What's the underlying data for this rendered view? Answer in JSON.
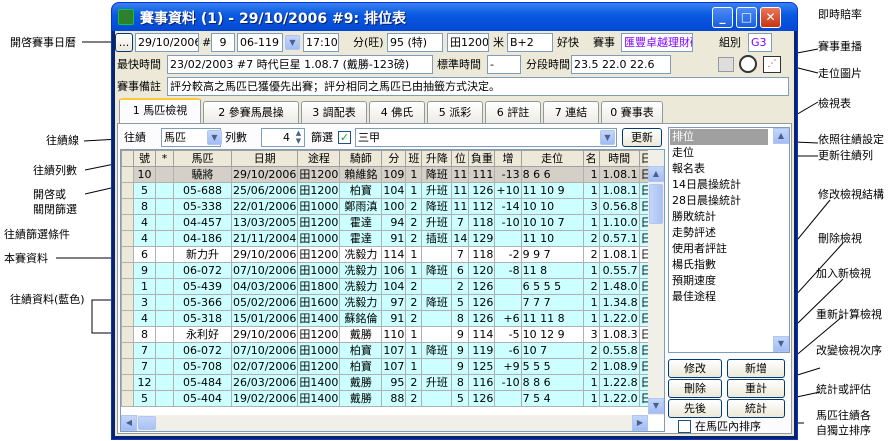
{
  "window": {
    "title": "賽事資料 (1) - 29/10/2006 #9: 排位表"
  },
  "row1": {
    "date_btn": "...",
    "date": "29/10/2006",
    "hash": "#",
    "race_no": "9",
    "race_code": "06-119",
    "time": "17:10",
    "score_label": "分(旺)",
    "score": "95 (特)",
    "distance": "田1200",
    "meter_label": "米",
    "going": "B+2",
    "going_note": "好快",
    "race_label": "賽事",
    "race_name": "匯豐卓越理財碗",
    "group_label": "組別",
    "group": "G3"
  },
  "row2": {
    "fastest_label": "最快時間",
    "fastest": "23/02/2003 #7 時代巨星 1.08.7 (戴勝-123磅)",
    "std_label": "標準時間",
    "std": "-",
    "split_label": "分段時間",
    "split": "23.5  22.0  22.6"
  },
  "row3": {
    "note_label": "賽事備註",
    "note": "評分較高之馬匹已獲優先出賽；評分相同之馬匹已由抽籤方式決定。"
  },
  "tabs": [
    {
      "label": "1 馬匹檢視"
    },
    {
      "label": "2 參賽馬晨操"
    },
    {
      "label": "3 調配表"
    },
    {
      "label": "4 佛氏"
    },
    {
      "label": "5 派彩"
    },
    {
      "label": "6 評註"
    },
    {
      "label": "7 連結"
    },
    {
      "label": "0 賽事表"
    }
  ],
  "filter": {
    "past_label": "往績",
    "past_value": "馬匹",
    "cols_label": "列數",
    "cols_value": "4",
    "filter_label": "篩選",
    "filter_value": "三甲",
    "update_btn": "更新"
  },
  "grid": {
    "headers": [
      "號",
      "*",
      "馬匹",
      "日期",
      "途程",
      "騎師",
      "分",
      "班",
      "升降",
      "位",
      "負重",
      "增",
      "走位",
      "名",
      "時間",
      "日"
    ],
    "rows": [
      {
        "t": "sel",
        "c": [
          "10",
          "",
          "驍將",
          "29/10/2006",
          "田1200",
          "賴維銘",
          "109",
          "1",
          "降班",
          "11",
          "111",
          "-13",
          "8  6  6",
          "1",
          "1.08.1",
          "日"
        ]
      },
      {
        "t": "blue",
        "c": [
          "5",
          "",
          "05-688",
          "25/06/2006",
          "田1200",
          "柏寶",
          "104",
          "1",
          "升班",
          "11",
          "126",
          "+10",
          "11 10 9",
          "1",
          "1.08.1",
          "日"
        ]
      },
      {
        "t": "blue",
        "c": [
          "8",
          "",
          "05-338",
          "22/01/2006",
          "田1000",
          "鄭雨滇",
          "100",
          "2",
          "降班",
          "11",
          "112",
          "-14",
          "10 10",
          "3",
          "0.56.8",
          "日"
        ]
      },
      {
        "t": "blue",
        "c": [
          "4",
          "",
          "04-457",
          "13/03/2005",
          "田1200",
          "霍達",
          "94",
          "2",
          "升班",
          "7",
          "118",
          "-10",
          "10 10 7",
          "1",
          "1.10.0",
          "日"
        ]
      },
      {
        "t": "blue",
        "c": [
          "4",
          "",
          "04-186",
          "21/11/2004",
          "田1000",
          "霍達",
          "91",
          "2",
          "插班",
          "14",
          "129",
          "",
          "11 10",
          "2",
          "0.57.1",
          "日"
        ]
      },
      {
        "t": "white",
        "c": [
          "6",
          "",
          "新力升",
          "29/10/2006",
          "田1200",
          "冼毅力",
          "114",
          "1",
          "",
          "7",
          "118",
          "-2",
          "9  9  7",
          "2",
          "1.08.1",
          "日"
        ]
      },
      {
        "t": "blue",
        "c": [
          "9",
          "",
          "06-072",
          "07/10/2006",
          "田1000",
          "冼毅力",
          "106",
          "1",
          "降班",
          "6",
          "120",
          "-8",
          "11 8",
          "1",
          "0.55.7",
          "日"
        ]
      },
      {
        "t": "blue",
        "c": [
          "1",
          "",
          "05-439",
          "04/03/2006",
          "田1800",
          "冼毅力",
          "104",
          "2",
          "",
          "2",
          "126",
          "",
          "6  5  5  5",
          "2",
          "1.48.0",
          "日"
        ]
      },
      {
        "t": "blue",
        "c": [
          "3",
          "",
          "05-366",
          "05/02/2006",
          "田1600",
          "冼毅力",
          "97",
          "2",
          "降班",
          "5",
          "126",
          "",
          "7  7  7",
          "1",
          "1.34.8",
          "日"
        ]
      },
      {
        "t": "blue",
        "c": [
          "4",
          "",
          "05-318",
          "15/01/2006",
          "田1400",
          "蘇銘倫",
          "91",
          "2",
          "",
          "8",
          "126",
          "+6",
          "11 11 8",
          "1",
          "1.22.0",
          "日"
        ]
      },
      {
        "t": "white",
        "c": [
          "8",
          "",
          "永利好",
          "29/10/2006",
          "田1200",
          "戴勝",
          "110",
          "1",
          "",
          "9",
          "114",
          "-5",
          "10 12 9",
          "3",
          "1.08.3",
          "日"
        ]
      },
      {
        "t": "blue",
        "c": [
          "7",
          "",
          "06-072",
          "07/10/2006",
          "田1000",
          "柏寶",
          "107",
          "1",
          "降班",
          "9",
          "119",
          "-6",
          "10 7",
          "2",
          "0.55.8",
          "日"
        ]
      },
      {
        "t": "blue",
        "c": [
          "7",
          "",
          "05-708",
          "02/07/2006",
          "田1200",
          "柏寶",
          "107",
          "1",
          "",
          "9",
          "125",
          "+9",
          "5  5  5",
          "2",
          "1.08.9",
          "日"
        ]
      },
      {
        "t": "blue",
        "c": [
          "12",
          "",
          "05-484",
          "26/03/2006",
          "田1400",
          "戴勝",
          "95",
          "2",
          "升班",
          "8",
          "116",
          "-10",
          "8  8  6",
          "1",
          "1.22.8",
          "日"
        ]
      },
      {
        "t": "blue",
        "c": [
          "5",
          "",
          "05-404",
          "19/02/2006",
          "田1400",
          "戴勝",
          "88",
          "2",
          "",
          "5",
          "126",
          "",
          "7  5  4",
          "1",
          "1.22.0",
          "日"
        ]
      }
    ]
  },
  "views": {
    "items": [
      "排位",
      "走位",
      "報名表",
      "14日晨操統計",
      "28日晨操統計",
      "勝敗統計",
      "走勢評述",
      "使用者評註",
      "楊氏指數",
      "預期速度",
      "最佳途程"
    ],
    "btn_edit": "修改",
    "btn_add": "新增",
    "btn_delete": "刪除",
    "btn_recalc": "重計",
    "btn_order": "先後",
    "btn_stats": "統計",
    "check_label": "在馬匹內排序"
  },
  "annotations": {
    "left": [
      "開啓賽事日曆",
      "往績線",
      "往績列數",
      "開啓或",
      "關閉篩選",
      "往績篩選條件",
      "本賽資料",
      "往績資料(藍色)"
    ],
    "right": [
      "即時賠率",
      "賽事重播",
      "走位圖片",
      "檢視表",
      "依照往績設定",
      "更新往績列",
      "修改檢視結構",
      "刪除檢視",
      "加入新檢視",
      "重新計算檢視",
      "改變檢視次序",
      "統計或評估",
      "馬匹往績各",
      "自獨立排序"
    ]
  }
}
